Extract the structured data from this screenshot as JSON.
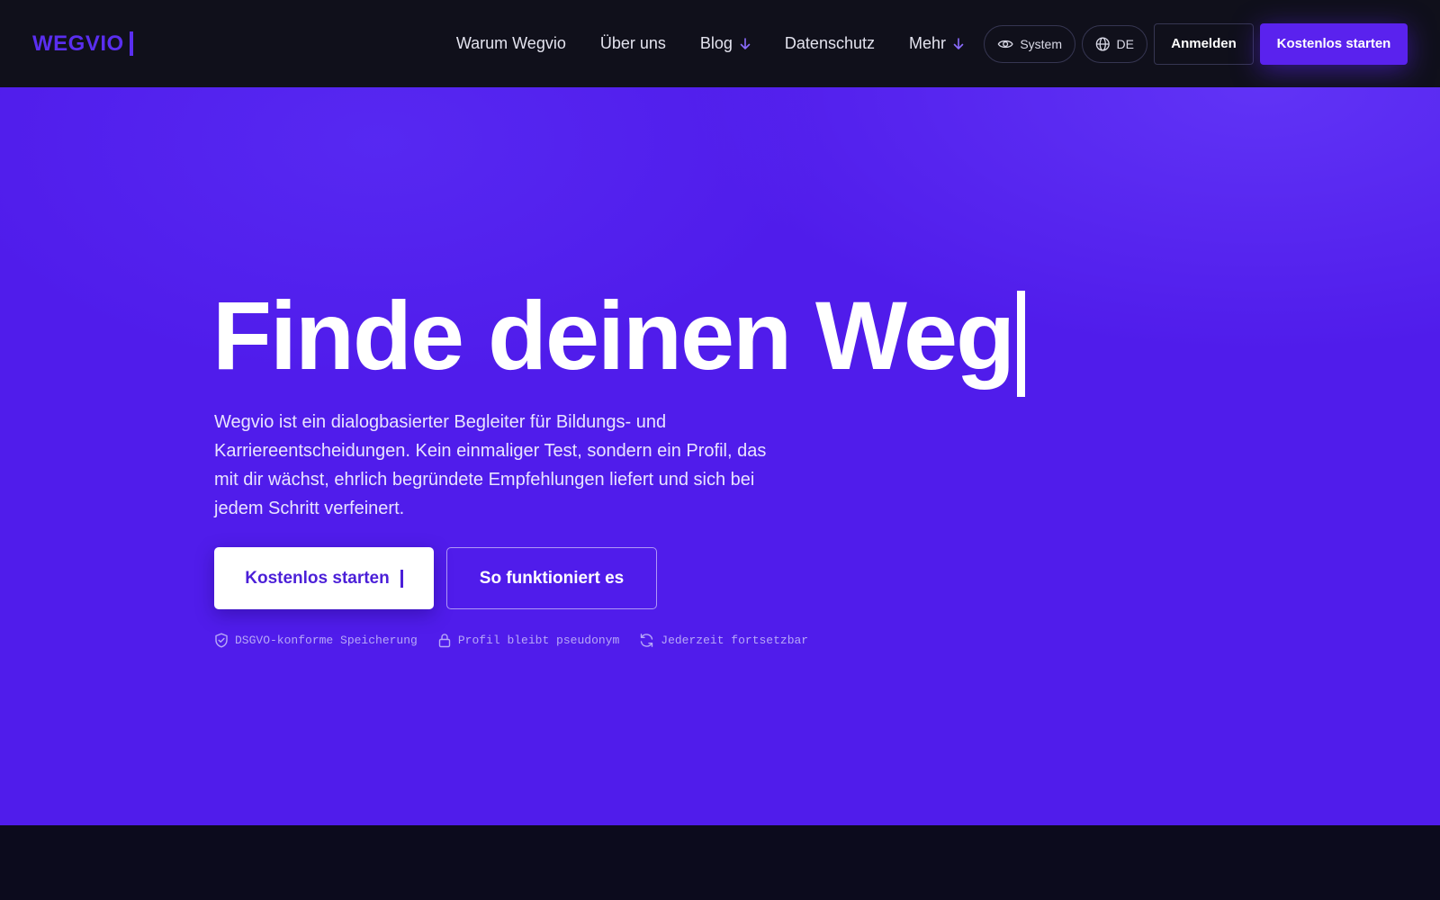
{
  "nav": {
    "logo": "WEGVIO",
    "links": [
      {
        "label": "Warum Wegvio",
        "dropdown": false
      },
      {
        "label": "Über uns",
        "dropdown": false
      },
      {
        "label": "Blog",
        "dropdown": true
      },
      {
        "label": "Datenschutz",
        "dropdown": false
      },
      {
        "label": "Mehr",
        "dropdown": true
      }
    ],
    "theme_label": "System",
    "lang_label": "DE",
    "login_label": "Anmelden",
    "start_label": "Kostenlos starten"
  },
  "hero": {
    "title": "Finde deinen Weg",
    "description": "Wegvio ist ein dialogbasierter Begleiter für Bildungs- und Karriereentscheidungen. Kein einmaliger Test, sondern ein Profil, das mit dir wächst, ehrlich begründete Empfehlungen liefert und sich bei jedem Schritt verfeinert.",
    "cta_primary": "Kostenlos starten",
    "cta_secondary": "So funktioniert es",
    "badges": [
      {
        "icon": "shield-check-icon",
        "label": "DSGVO-konforme Speicherung"
      },
      {
        "icon": "lock-icon",
        "label": "Profil bleibt pseudonym"
      },
      {
        "icon": "refresh-icon",
        "label": "Jederzeit fortsetzbar"
      }
    ]
  },
  "colors": {
    "nav_bg": "#10101b",
    "hero_bg": "#501ceb",
    "accent": "#5a22ee",
    "footer_bg": "#0c0b1d"
  }
}
